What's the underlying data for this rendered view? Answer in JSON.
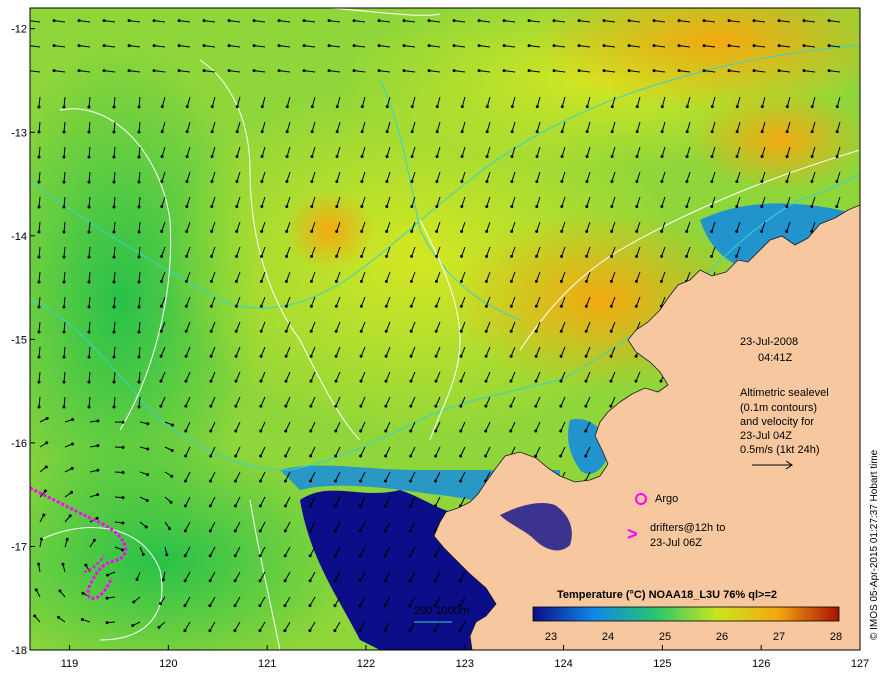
{
  "map": {
    "lon_ticks": [
      "119",
      "120",
      "121",
      "122",
      "123",
      "124",
      "125",
      "126",
      "127"
    ],
    "lat_ticks": [
      "-12",
      "-13",
      "-14",
      "-15",
      "-16",
      "-17",
      "-18"
    ],
    "lon_range": [
      118.6,
      127
    ],
    "lat_range": [
      -11.8,
      -18
    ],
    "colors": {
      "land": "#f7c8a0",
      "sst_23": "#0b0e88",
      "sst_24": "#0f88e8",
      "sst_25": "#27c56f",
      "sst_26": "#c8e61f",
      "sst_27": "#f6a70f",
      "sst_28": "#a81006",
      "contour": "#ffffff",
      "isobath": "#35d3d0",
      "drifter": "#ff00ff"
    }
  },
  "annotations": {
    "date": "23-Jul-2008",
    "time": "04:41Z",
    "sealevel_lines": [
      "Altimetric sealevel",
      "(0.1m contours)",
      "and velocity for",
      "23-Jul 04Z",
      "0.5m/s (1kt 24h)"
    ],
    "argo_label": "Argo",
    "drifter_lines": [
      "drifters@12h to",
      "23-Jul 06Z"
    ],
    "isobath_label": "200  1000m"
  },
  "colorbar": {
    "title": "Temperature (°C) NOAA18_L3U 76% ql>=2",
    "tick_labels": [
      "23",
      "24",
      "25",
      "26",
      "27",
      "28"
    ]
  },
  "credit": "© IMOS 05-Apr-2015 01:27:37 Hobart time"
}
